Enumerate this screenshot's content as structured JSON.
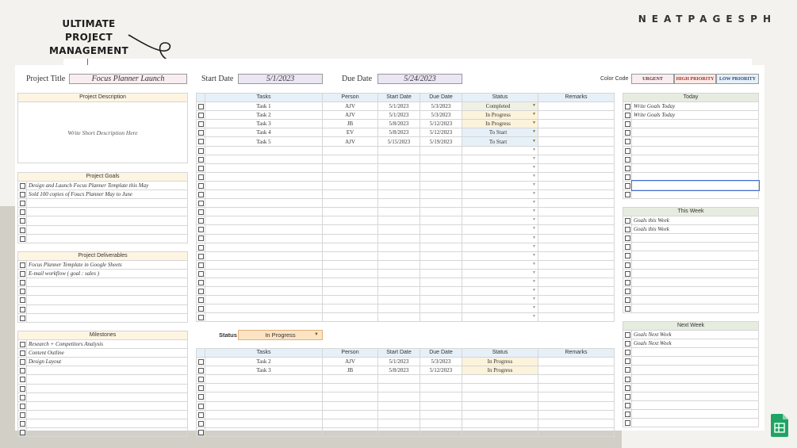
{
  "banner": {
    "title_line1": "ULTIMATE PROJECT",
    "title_line2": "MANAGEMENT",
    "brand": "NEATPAGESPH"
  },
  "header": {
    "project_title_label": "Project Title",
    "project_title_value": "Focus Planner Launch",
    "start_date_label": "Start Date",
    "start_date_value": "5/1/2023",
    "due_date_label": "Due Date",
    "due_date_value": "5/24/2023",
    "color_code_label": "Color Code",
    "color_codes": [
      "URGENT",
      "HIGH PRIORITY",
      "LOW PRIORITY"
    ]
  },
  "colors": {
    "urgent": "#f8eef1",
    "high_priority": "#fbeae7",
    "low_priority": "#e6f0f8",
    "selection": "#3a6fd8",
    "band": "#d2cfc6"
  },
  "project_description": {
    "header": "Project Description",
    "placeholder": "Write Short Description Here"
  },
  "project_goals": {
    "header": "Project Goals",
    "items": [
      "Design and Launch Focus Planner Template this May",
      "Sold 100 copies of Foucs Planner May to June",
      "",
      "",
      "",
      "",
      ""
    ]
  },
  "project_deliverables": {
    "header": "Project Deliverables",
    "items": [
      "Focus Planner Template in Google Sheets",
      "E-mail workflow ( goal : sales )",
      "",
      "",
      "",
      "",
      ""
    ]
  },
  "milestones": {
    "header": "Milestones",
    "items": [
      "Research + Competitors Analysis",
      "Content Outline",
      "Design Layout",
      "",
      "",
      "",
      "",
      "",
      "",
      "",
      ""
    ]
  },
  "tasks_table": {
    "columns": [
      "Tasks",
      "Person",
      "Start Date",
      "Due Date",
      "Status",
      "Remarks"
    ],
    "rows": [
      [
        "Task 1",
        "AJV",
        "5/1/2023",
        "5/3/2023",
        "Completed",
        ""
      ],
      [
        "Task 2",
        "AJV",
        "5/1/2023",
        "5/3/2023",
        "In Progress",
        ""
      ],
      [
        "Task 3",
        "JB",
        "5/8/2023",
        "5/12/2023",
        "In Progress",
        ""
      ],
      [
        "Task 4",
        "EV",
        "5/8/2023",
        "5/12/2023",
        "To Start",
        ""
      ],
      [
        "Task 5",
        "AJV",
        "5/15/2023",
        "5/19/2023",
        "To Start",
        ""
      ]
    ],
    "blank_rows": 20
  },
  "filter": {
    "label": "Status",
    "value": "In Progress"
  },
  "filtered_table": {
    "columns": [
      "Tasks",
      "Person",
      "Start Date",
      "Due Date",
      "Status",
      "Remarks"
    ],
    "rows": [
      [
        "Task 2",
        "AJV",
        "5/1/2023",
        "5/3/2023",
        "In Progress",
        ""
      ],
      [
        "Task 3",
        "JB",
        "5/8/2023",
        "5/12/2023",
        "In Progress",
        ""
      ]
    ],
    "blank_rows": 7
  },
  "today": {
    "header": "Today",
    "items": [
      "Write Goals Today",
      "Write Goals Today",
      "",
      "",
      "",
      "",
      "",
      "",
      "",
      "",
      ""
    ]
  },
  "this_week": {
    "header": "This Week",
    "items": [
      "Goals this Week",
      "Goals this Week",
      "",
      "",
      "",
      "",
      "",
      "",
      "",
      "",
      ""
    ]
  },
  "next_week": {
    "header": "Next Week",
    "items": [
      "Goals Next Week",
      "Goals Next Week",
      "",
      "",
      "",
      "",
      "",
      "",
      "",
      "",
      ""
    ]
  }
}
